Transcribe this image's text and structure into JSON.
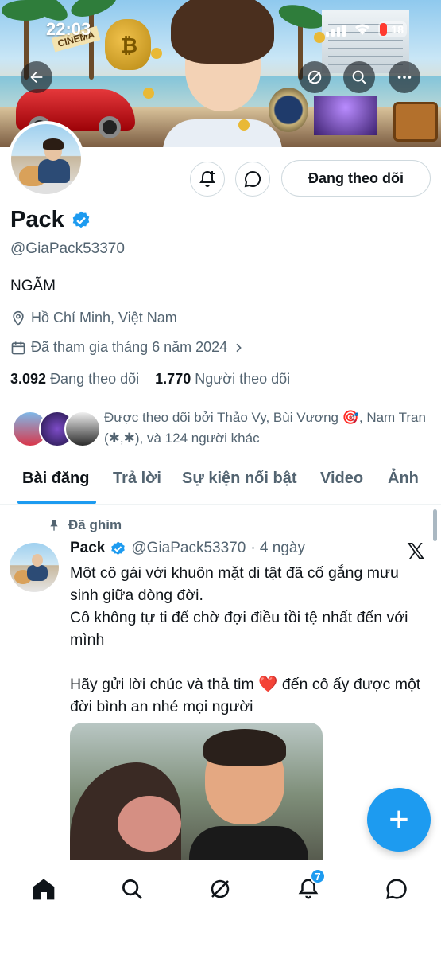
{
  "status_bar": {
    "time": "22:03",
    "battery": "18",
    "battery_color": "#ff3b30"
  },
  "banner": {
    "sign_text": "CINEMA",
    "icons": [
      "back-arrow-icon",
      "grok-icon",
      "search-icon",
      "more-icon"
    ]
  },
  "profile": {
    "name": "Pack",
    "verified": true,
    "handle": "@GiaPack53370",
    "bio": "NGẪM",
    "location": "Hồ Chí Minh, Việt Nam",
    "joined": "Đã tham gia tháng 6 năm 2024",
    "following_count": "3.092",
    "following_label": "Đang theo dõi",
    "followers_count": "1.770",
    "followers_label": "Người theo dõi",
    "followed_by_text": "Được theo dõi bởi Thảo Vy, Bùi Vương 🎯, Nam Tran (✱,✱), và 124 người khác",
    "follow_button": "Đang theo dõi"
  },
  "tabs": [
    {
      "label": "Bài đăng",
      "active": true
    },
    {
      "label": "Trả lời",
      "active": false
    },
    {
      "label": "Sự kiện nổi bật",
      "active": false
    },
    {
      "label": "Video",
      "active": false
    },
    {
      "label": "Ảnh",
      "active": false
    }
  ],
  "post": {
    "pinned_label": "Đã ghim",
    "author_name": "Pack",
    "author_handle": "@GiaPack53370",
    "time": "· 4 ngày",
    "source_logo": "𝕏",
    "lines": [
      "Một cô gái với khuôn mặt di tật đã cố gắng mưu sinh giữa dòng đời.",
      "Cô không tự ti để chờ đợi điều tồi tệ nhất đến với mình",
      "",
      "Hãy gửi lời chúc và thả tim ❤️ đến cô ấy được một đời bình an nhé mọi người"
    ]
  },
  "fab_label": "+",
  "bottom_nav": {
    "items": [
      "home-icon",
      "search-icon",
      "grok-icon",
      "notifications-icon",
      "messages-icon"
    ],
    "notification_count": "7"
  },
  "colors": {
    "accent": "#1d9bf0",
    "text_primary": "#0f1419",
    "text_secondary": "#536471",
    "border": "#cfd9de"
  }
}
